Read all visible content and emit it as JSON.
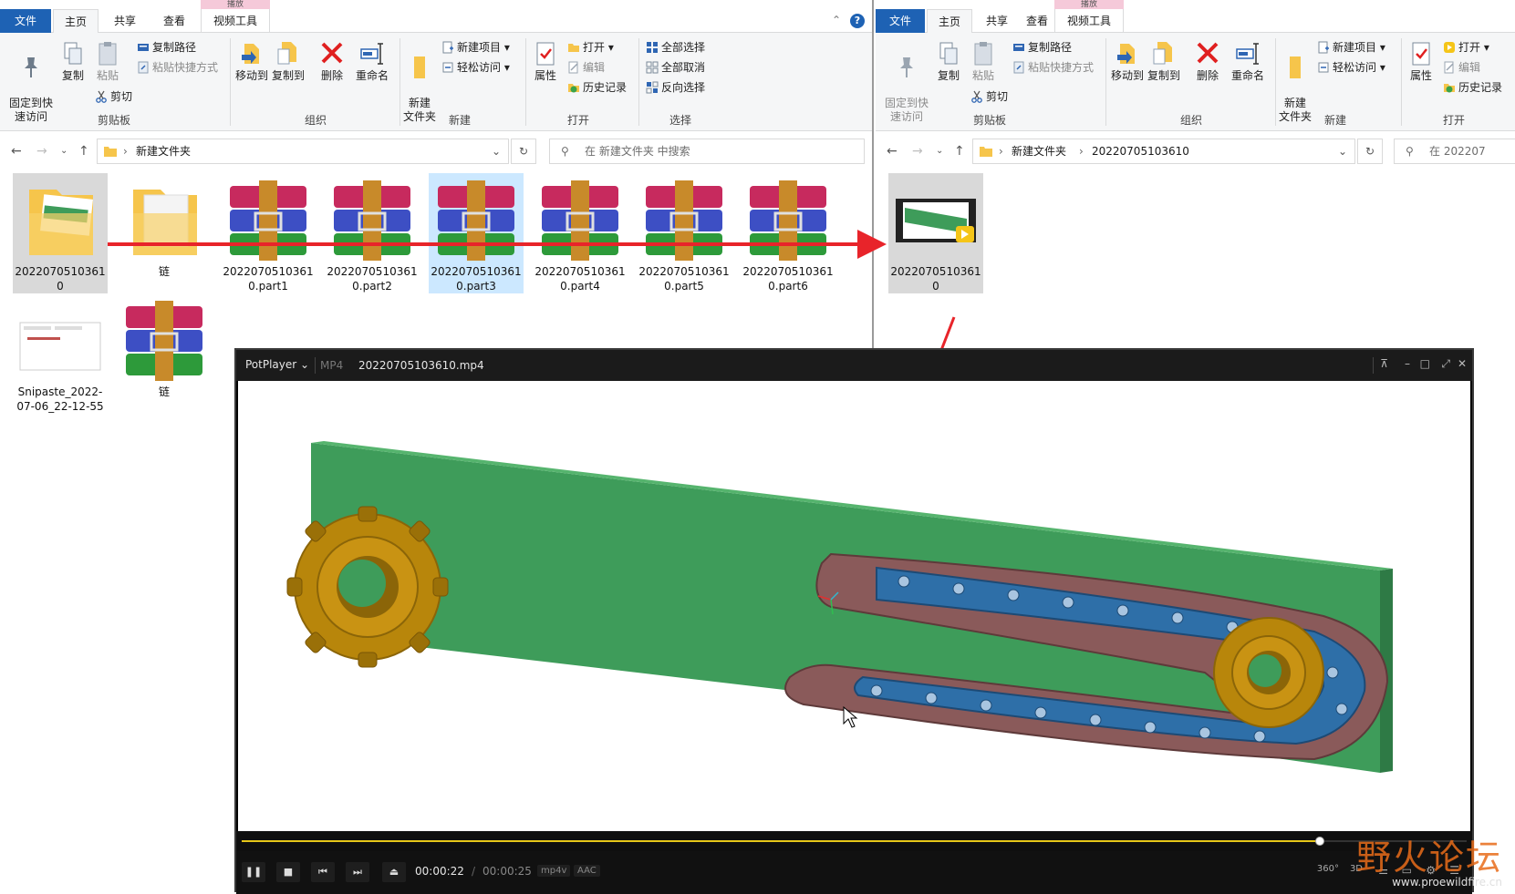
{
  "left": {
    "context_tab_header": "播放",
    "tabs": [
      "文件",
      "主页",
      "共享",
      "查看",
      "视频工具"
    ],
    "ribbon": {
      "pin_label": "固定到快\n速访问",
      "copy_label": "复制",
      "paste_label": "粘贴",
      "copy_path": "复制路径",
      "paste_shortcut": "粘贴快捷方式",
      "cut": "剪切",
      "move_to": "移动到",
      "copy_to": "复制到",
      "delete": "删除",
      "rename": "重命名",
      "new_folder": "新建\n文件夹",
      "new_item": "新建项目",
      "easy_access": "轻松访问",
      "properties": "属性",
      "open": "打开",
      "edit": "编辑",
      "history": "历史记录",
      "select_all": "全部选择",
      "select_none": "全部取消",
      "invert_selection": "反向选择",
      "groups": [
        "剪贴板",
        "组织",
        "新建",
        "打开",
        "选择"
      ]
    },
    "address": {
      "path": "新建文件夹"
    },
    "search_placeholder": "在 新建文件夹 中搜索",
    "files": [
      {
        "name": "20220705103610",
        "type": "folder-thumb"
      },
      {
        "name": "链",
        "type": "folder-blank"
      },
      {
        "name": "20220705103610.part1",
        "type": "rar"
      },
      {
        "name": "20220705103610.part2",
        "type": "rar"
      },
      {
        "name": "20220705103610.part3",
        "type": "rar"
      },
      {
        "name": "20220705103610.part4",
        "type": "rar"
      },
      {
        "name": "20220705103610.part5",
        "type": "rar"
      },
      {
        "name": "20220705103610.part6",
        "type": "rar"
      },
      {
        "name": "Snipaste_2022-07-06_22-12-55",
        "type": "image"
      },
      {
        "name": "链",
        "type": "rar"
      }
    ]
  },
  "right": {
    "context_tab_header": "播放",
    "tabs": [
      "文件",
      "主页",
      "共享",
      "查看",
      "视频工具"
    ],
    "ribbon": {
      "pin_label": "固定到快\n速访问",
      "copy_label": "复制",
      "paste_label": "粘贴",
      "copy_path": "复制路径",
      "paste_shortcut": "粘贴快捷方式",
      "cut": "剪切",
      "move_to": "移动到",
      "copy_to": "复制到",
      "delete": "删除",
      "rename": "重命名",
      "new_folder": "新建\n文件夹",
      "new_item": "新建项目",
      "easy_access": "轻松访问",
      "properties": "属性",
      "open": "打开",
      "edit": "编辑",
      "history": "历史记录",
      "groups": [
        "剪贴板",
        "组织",
        "新建",
        "打开"
      ]
    },
    "address": {
      "path1": "新建文件夹",
      "path2": "20220705103610"
    },
    "search_placeholder": "在 202207",
    "files": [
      {
        "name": "20220705103610",
        "type": "video"
      }
    ]
  },
  "player": {
    "app": "PotPlayer",
    "format": "MP4",
    "filename": "20220705103610.mp4",
    "progress": 0.88,
    "time_current": "00:00:22",
    "time_separator": "/",
    "time_total": "00:00:25",
    "video_codec": "mp4v",
    "audio_codec": "AAC",
    "right_labels": [
      "360°",
      "3D"
    ],
    "icons": [
      "pin-icon",
      "minimize-icon",
      "maximize-icon",
      "fullscreen-icon",
      "close-icon"
    ]
  },
  "watermark": {
    "brand": "野火论坛",
    "url": "www.proewildfire.cn"
  },
  "colors": {
    "file_tab": "#1e62b4",
    "selection": "#cce8ff",
    "arrow": "#e8242a",
    "rail": "#3e9c5a",
    "sprocket": "#b8860b",
    "chain_outer": "#8a5a5a",
    "chain_inner": "#2e6fa8",
    "seek": "#e6c619"
  }
}
